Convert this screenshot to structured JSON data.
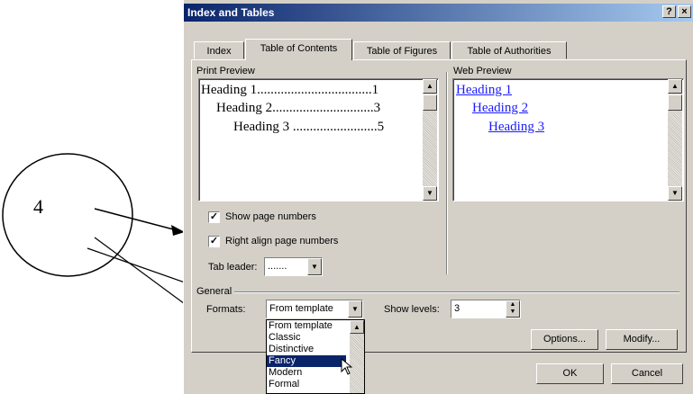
{
  "window": {
    "title": "Index and Tables",
    "help_label": "?",
    "close_label": "×"
  },
  "tabs": [
    {
      "label": "Index"
    },
    {
      "label": "Table of Contents"
    },
    {
      "label": "Table of Figures"
    },
    {
      "label": "Table of Authorities"
    }
  ],
  "print_preview": {
    "label": "Print Preview",
    "lines": [
      "Heading 1..................................1",
      "Heading 2..............................3",
      "Heading 3 .........................5"
    ]
  },
  "web_preview": {
    "label": "Web Preview",
    "links": [
      "Heading 1",
      "Heading 2",
      "Heading 3"
    ]
  },
  "options": {
    "show_page_numbers": {
      "label": "Show page numbers",
      "checked": true
    },
    "right_align": {
      "label": "Right align page numbers",
      "checked": true
    },
    "tab_leader": {
      "label": "Tab leader:",
      "value": "......."
    }
  },
  "general": {
    "label": "General",
    "formats_label": "Formats:",
    "formats_value": "From template",
    "format_options": [
      "From template",
      "Classic",
      "Distinctive",
      "Fancy",
      "Modern",
      "Formal"
    ],
    "selected_option": "Fancy",
    "show_levels_label": "Show levels:",
    "show_levels_value": "3"
  },
  "buttons": {
    "options": "Options...",
    "modify": "Modify...",
    "ok": "OK",
    "cancel": "Cancel"
  },
  "callout": {
    "label": "4"
  }
}
